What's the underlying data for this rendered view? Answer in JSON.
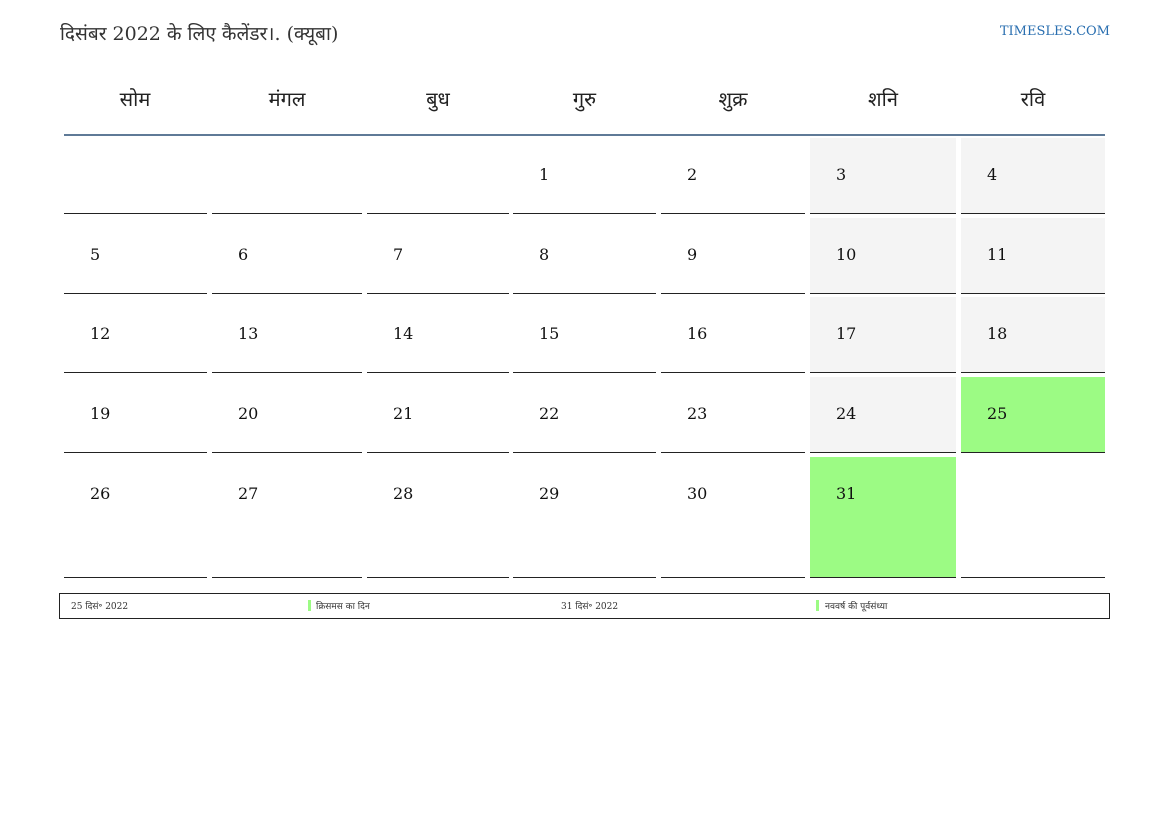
{
  "header": {
    "title": "दिसंबर 2022 के लिए कैलेंडर।. (क्यूबा)",
    "site": "TIMESLES.COM"
  },
  "weekdays": [
    "सोम",
    "मंगल",
    "बुध",
    "गुरु",
    "शुक्र",
    "शनि",
    "रवि"
  ],
  "weeks": [
    [
      "",
      "",
      "",
      "1",
      "2",
      "3",
      "4"
    ],
    [
      "5",
      "6",
      "7",
      "8",
      "9",
      "10",
      "11"
    ],
    [
      "12",
      "13",
      "14",
      "15",
      "16",
      "17",
      "18"
    ],
    [
      "19",
      "20",
      "21",
      "22",
      "23",
      "24",
      "25"
    ],
    [
      "26",
      "27",
      "28",
      "29",
      "30",
      "31",
      ""
    ]
  ],
  "colors": {
    "holiday": "#9cfb84",
    "weekend": "#f4f4f4",
    "header_rule": "#5f7a97"
  },
  "holiday_days": [
    "25",
    "31"
  ],
  "legend": [
    {
      "date": "25 दिसं॰ 2022",
      "name": "क्रिसमस का दिन"
    },
    {
      "date": "31 दिसं॰ 2022",
      "name": "नववर्ष की पूर्वसंध्या"
    }
  ]
}
